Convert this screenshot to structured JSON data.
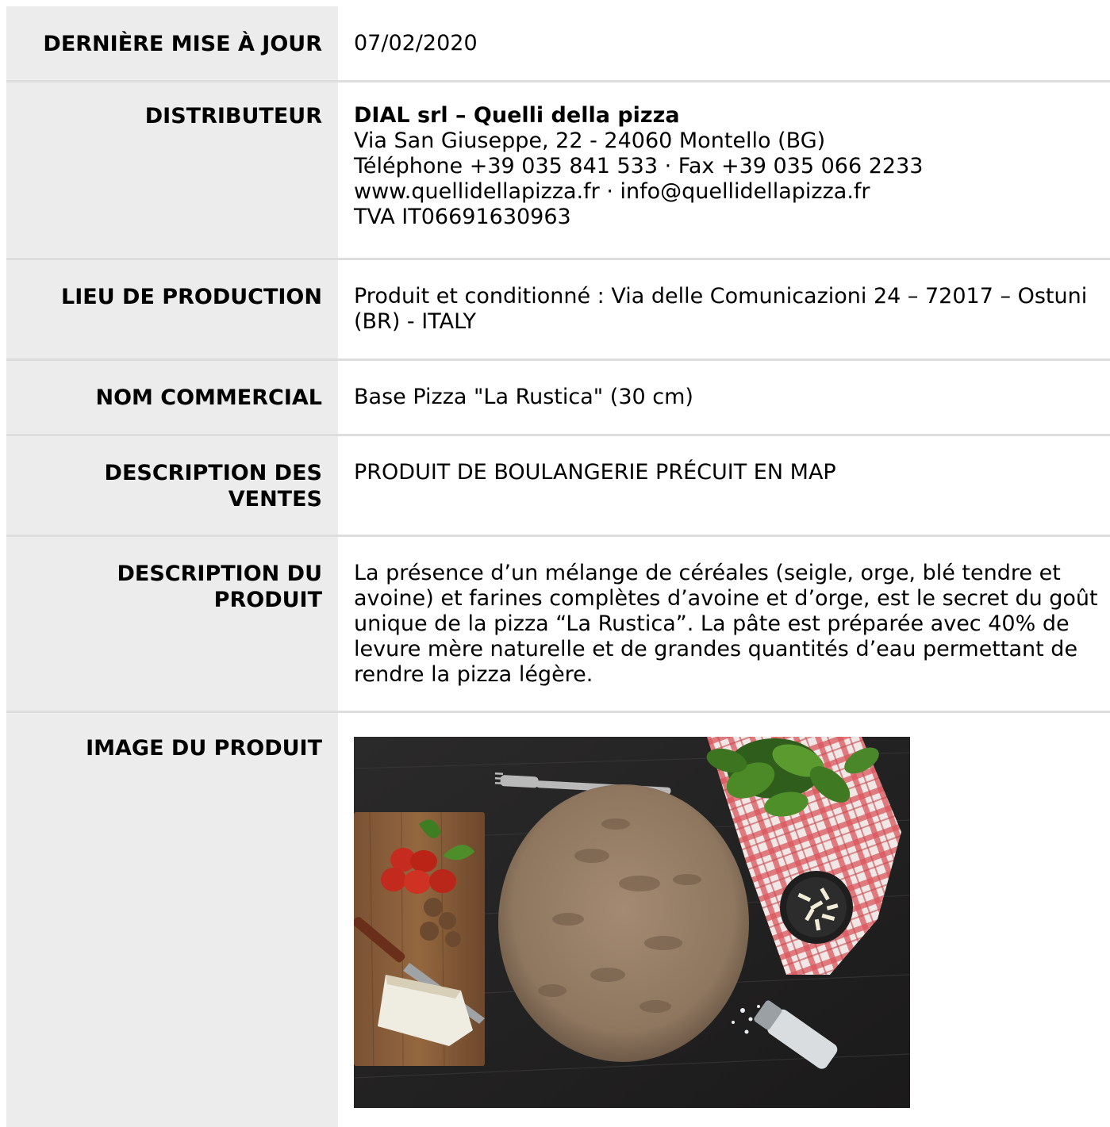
{
  "rows": [
    {
      "label": "DERNIÈRE MISE À JOUR",
      "value": "07/02/2020"
    },
    {
      "label": "DISTRIBUTEUR",
      "name": "DIAL srl – Quelli della pizza",
      "lines": [
        "Via San Giuseppe, 22 - 24060 Montello (BG)",
        "Téléphone +39 035 841 533 · Fax +39 035 066 2233",
        "www.quellidellapizza.fr · info@quellidellapizza.fr",
        "TVA IT06691630963"
      ]
    },
    {
      "label": "LIEU DE PRODUCTION",
      "value": "Produit et conditionné : Via delle Comunicazioni 24 – 72017 – Ostuni (BR) - ITALY"
    },
    {
      "label": "NOM COMMERCIAL",
      "value": "Base Pizza \"La Rustica\" (30 cm)"
    },
    {
      "label": "DESCRIPTION DES VENTES",
      "value": "PRODUIT DE BOULANGERIE PRÉCUIT EN MAP"
    },
    {
      "label": "DESCRIPTION DU PRODUIT",
      "value": "La présence d’un mélange de céréales (seigle, orge, blé tendre et avoine) et farines complètes d’avoine et d’orge, est le secret du goût unique de la pizza “La Rustica”. La pâte est préparée avec 40% de levure mère naturelle et de grandes quantités d’eau permettant de rendre la pizza légère."
    },
    {
      "label": "IMAGE DU PRODUIT"
    }
  ],
  "colors": {
    "label_bg": "#ececec",
    "divider": "#dddddd",
    "text": "#000000"
  }
}
